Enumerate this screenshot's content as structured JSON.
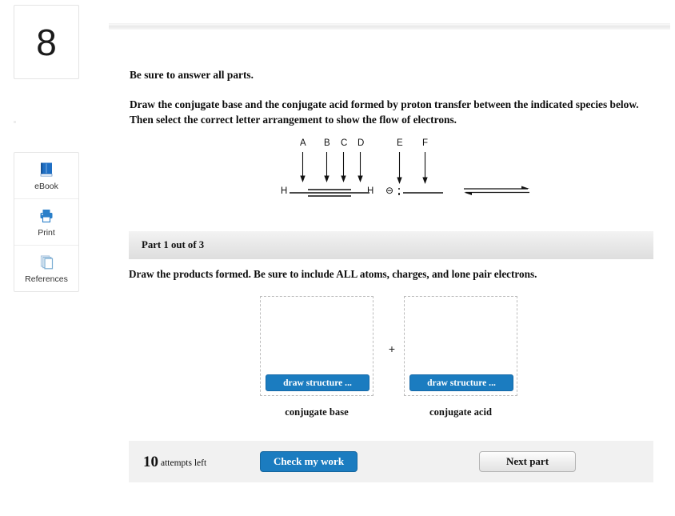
{
  "question_number": "8",
  "sidebar": {
    "tools": [
      {
        "label": "eBook",
        "icon": "ebook-icon"
      },
      {
        "label": "Print",
        "icon": "printer-icon"
      },
      {
        "label": "References",
        "icon": "references-icon"
      }
    ]
  },
  "question": {
    "intro": "Be sure to answer all parts.",
    "prompt": "Draw the conjugate base and the conjugate acid formed by proton transfer between the indicated species below. Then select the correct letter arrangement to show the flow of electrons."
  },
  "figure": {
    "labels": [
      "A",
      "B",
      "C",
      "D",
      "E",
      "F"
    ],
    "species_left": {
      "formula": "H—C≡C—H",
      "left_atom": "H",
      "right_atom": "H",
      "bond": "triple"
    },
    "species_right": {
      "charge": "⊖",
      "lone_pair": "lone-pair-dots",
      "bond": "single"
    },
    "reaction_arrow": "equilibrium-arrow"
  },
  "part": {
    "header": "Part 1 out of 3",
    "instruction": "Draw the products formed. Be sure to include ALL atoms, charges, and lone pair electrons."
  },
  "answers": {
    "plus": "+",
    "left": {
      "button_label": "draw structure ...",
      "caption": "conjugate base"
    },
    "right": {
      "button_label": "draw structure ...",
      "caption": "conjugate acid"
    }
  },
  "footer": {
    "attempts_count": "10",
    "attempts_text": "attempts left",
    "check_label": "Check my work",
    "next_label": "Next part"
  },
  "colors": {
    "accent_blue": "#1b7cc0",
    "bar_gray": "#e7e7e7",
    "footer_gray": "#f1f1f1"
  }
}
